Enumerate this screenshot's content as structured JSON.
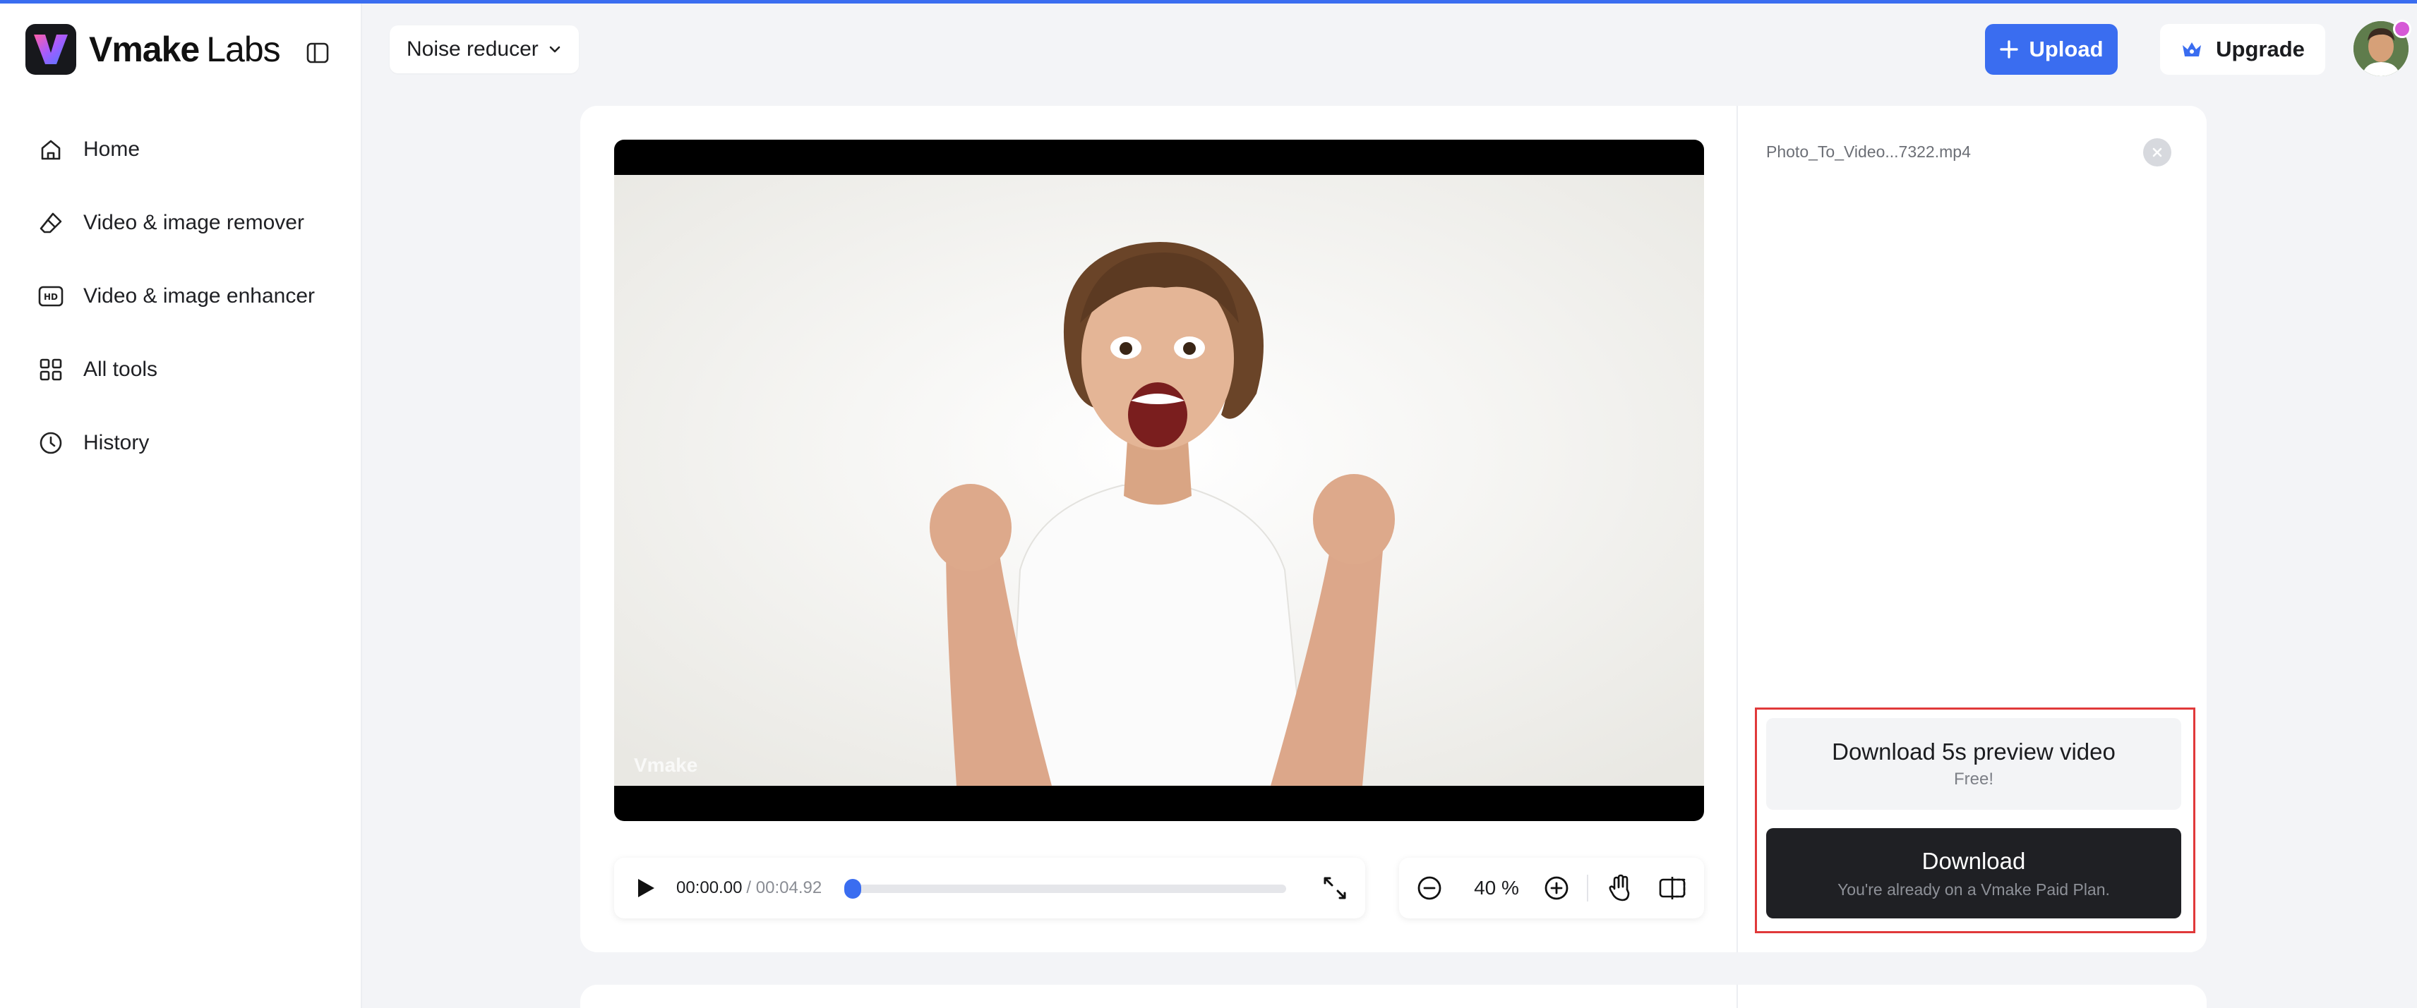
{
  "brand": {
    "name": "Vmake",
    "sub": "Labs",
    "logo_icon": "vmake-logo-icon"
  },
  "sidebar": {
    "items": [
      {
        "label": "Home",
        "icon": "home-icon"
      },
      {
        "label": "Video & image remover",
        "icon": "eraser-icon"
      },
      {
        "label": "Video & image enhancer",
        "icon": "hd-icon"
      },
      {
        "label": "All tools",
        "icon": "grid-icon"
      },
      {
        "label": "History",
        "icon": "clock-icon"
      }
    ]
  },
  "header": {
    "tool_select": "Noise reducer",
    "upload_label": "Upload",
    "upgrade_label": "Upgrade"
  },
  "video": {
    "watermark": "Vmake",
    "current_time": "00:00.00",
    "duration": "/ 00:04.92",
    "progress": 0,
    "zoom": "40 %"
  },
  "panel": {
    "file_name": "Photo_To_Video...7322.mp4",
    "preview_title": "Download 5s preview video",
    "preview_sub": "Free!",
    "download_title": "Download",
    "download_sub": "You're already on a Vmake Paid Plan."
  },
  "colors": {
    "accent": "#3a6df0",
    "highlight": "#e0393a",
    "dark_button": "#1f2024"
  }
}
